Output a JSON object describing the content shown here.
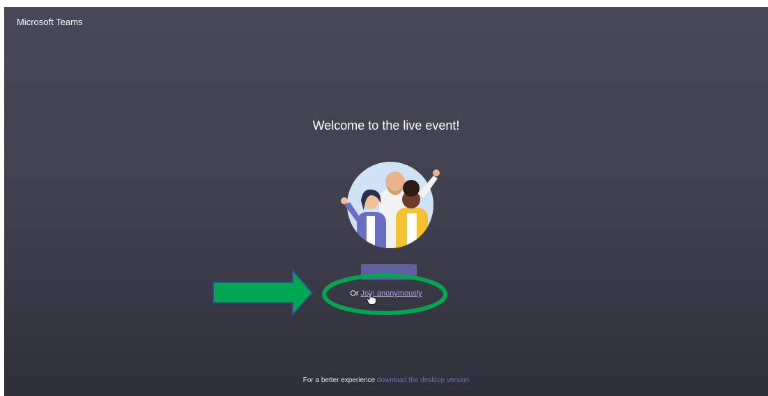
{
  "app": {
    "title": "Microsoft Teams"
  },
  "main": {
    "heading": "Welcome to the live event!",
    "join_button_label": "",
    "or_text": "Or",
    "anonymous_link": "Join anonymously"
  },
  "footer": {
    "prefix": "For a better experience",
    "link": "download the desktop version"
  },
  "colors": {
    "background": "#3f3f4e",
    "accent": "#6264a7",
    "annotation_green": "#00a651"
  },
  "icons": {
    "illustration": "people-waving-illustration",
    "cursor": "hand-pointer-icon",
    "arrow": "arrow-right-annotation",
    "ellipse": "highlight-ellipse-annotation"
  }
}
